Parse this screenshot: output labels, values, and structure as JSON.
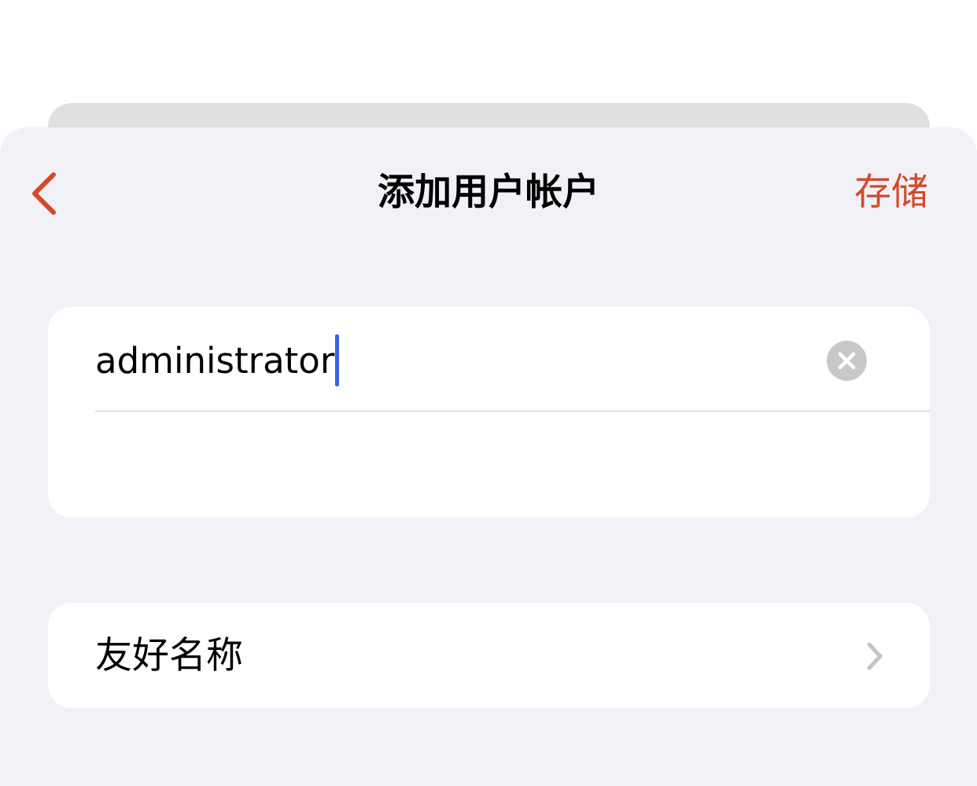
{
  "nav": {
    "back_icon": "chevron-left-icon",
    "title": "添加用户帐户",
    "save_label": "存储"
  },
  "account_form": {
    "username_value": "administrator",
    "clear_icon": "clear-circle-icon"
  },
  "friendly_name_row": {
    "label": "友好名称",
    "chevron_icon": "chevron-right-icon"
  },
  "colors": {
    "accent": "#d3492b",
    "caret": "#3a62e8",
    "background": "#f2f1f7",
    "card": "#ffffff"
  }
}
